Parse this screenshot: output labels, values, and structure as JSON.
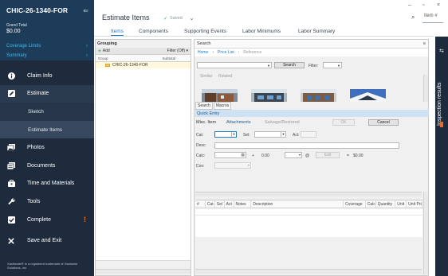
{
  "sidebar": {
    "claim_id": "CHIC-26-1340-FOR",
    "grand_total_label": "Grand Total",
    "grand_total_value": "$0.00",
    "links": [
      {
        "label": "Coverage Limits"
      },
      {
        "label": "Summary"
      }
    ],
    "nav": [
      {
        "label": "Claim Info",
        "icon": "info-icon"
      },
      {
        "label": "Estimate",
        "icon": "pencil-icon"
      },
      {
        "label": "Sketch",
        "sub": true
      },
      {
        "label": "Estimate Items",
        "sub": true
      },
      {
        "label": "Photos",
        "icon": "photos-icon"
      },
      {
        "label": "Documents",
        "icon": "documents-icon"
      },
      {
        "label": "Time and Materials",
        "icon": "briefcase-icon"
      },
      {
        "label": "Tools",
        "icon": "wrench-icon"
      },
      {
        "label": "Complete",
        "icon": "checkbox-icon"
      },
      {
        "label": "Save and Exit",
        "icon": "close-icon"
      }
    ],
    "footer": "Xactimate® is a registered trademark of Xactware Solutions, Inc."
  },
  "header": {
    "title": "Estimate Items",
    "saved": "Saved",
    "search_placeholder": "Item #"
  },
  "tabs": [
    {
      "label": "Items"
    },
    {
      "label": "Components"
    },
    {
      "label": "Supporting Events"
    },
    {
      "label": "Labor Minimums"
    },
    {
      "label": "Labor Summary"
    }
  ],
  "grouping": {
    "title": "Grouping",
    "add": "Add",
    "filter": "Filter (Off)",
    "col_group": "Group",
    "col_subtotal": "Subtotal",
    "row": "CHIC-26-1340-FOR"
  },
  "search": {
    "title": "Search",
    "breadcrumb": [
      "Home",
      "Price List",
      "Reference"
    ],
    "search_button": "Search",
    "filter_label": "Filter:",
    "similar": "Similar",
    "related": "Related",
    "subtabs": [
      "Search",
      "Macros"
    ]
  },
  "quick_entry": {
    "title": "Quick Entry",
    "tabs": [
      "Misc. Item",
      "Attachments",
      "Salvage/Restored"
    ],
    "ok": "OK",
    "cancel": "Cancel",
    "cat": "Cat:",
    "sel": "Sel:",
    "act": "Act:",
    "desc": "Desc:",
    "calc": "Calc:",
    "cov": "Cov:",
    "plus": "+",
    "qty": "0.00",
    "at": "@",
    "edit": "Edit",
    "eq": "=",
    "total": "$0.00"
  },
  "grid_columns": [
    "#",
    "Cat",
    "Sel",
    "Act",
    "Notes",
    "Description",
    "Coverage",
    "Calc",
    "Quantity",
    "Unit",
    "Unit Price"
  ],
  "right_panel": {
    "label": "Inspection results"
  },
  "colors": {
    "sidebar": "#1e2b3c",
    "accent": "#1e7bc2",
    "link": "#3fb6ef",
    "warning": "#e56b2c"
  }
}
